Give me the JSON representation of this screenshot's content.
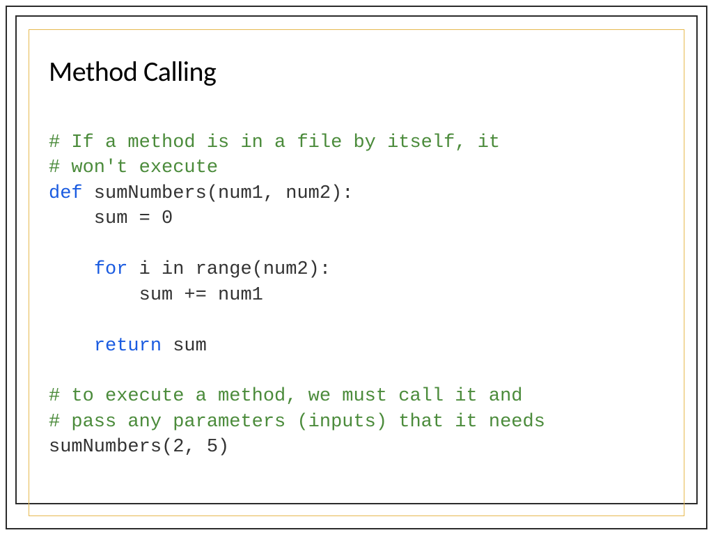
{
  "slide": {
    "title": "Method Calling",
    "code": {
      "c1": "# If a method is in a file by itself, it",
      "c2": "# won't execute",
      "kw_def": "def",
      "def_rest": " sumNumbers(num1, num2):",
      "l_sum0": "    sum = 0",
      "blank": "",
      "kw_for": "for",
      "for_prefix": "    ",
      "for_rest": " i in range(num2):",
      "l_inc": "        sum += num1",
      "kw_return": "return",
      "return_prefix": "    ",
      "return_rest": " sum",
      "c3": "# to execute a method, we must call it and",
      "c4": "# pass any parameters (inputs) that it needs",
      "call": "sumNumbers(2, 5)"
    }
  }
}
